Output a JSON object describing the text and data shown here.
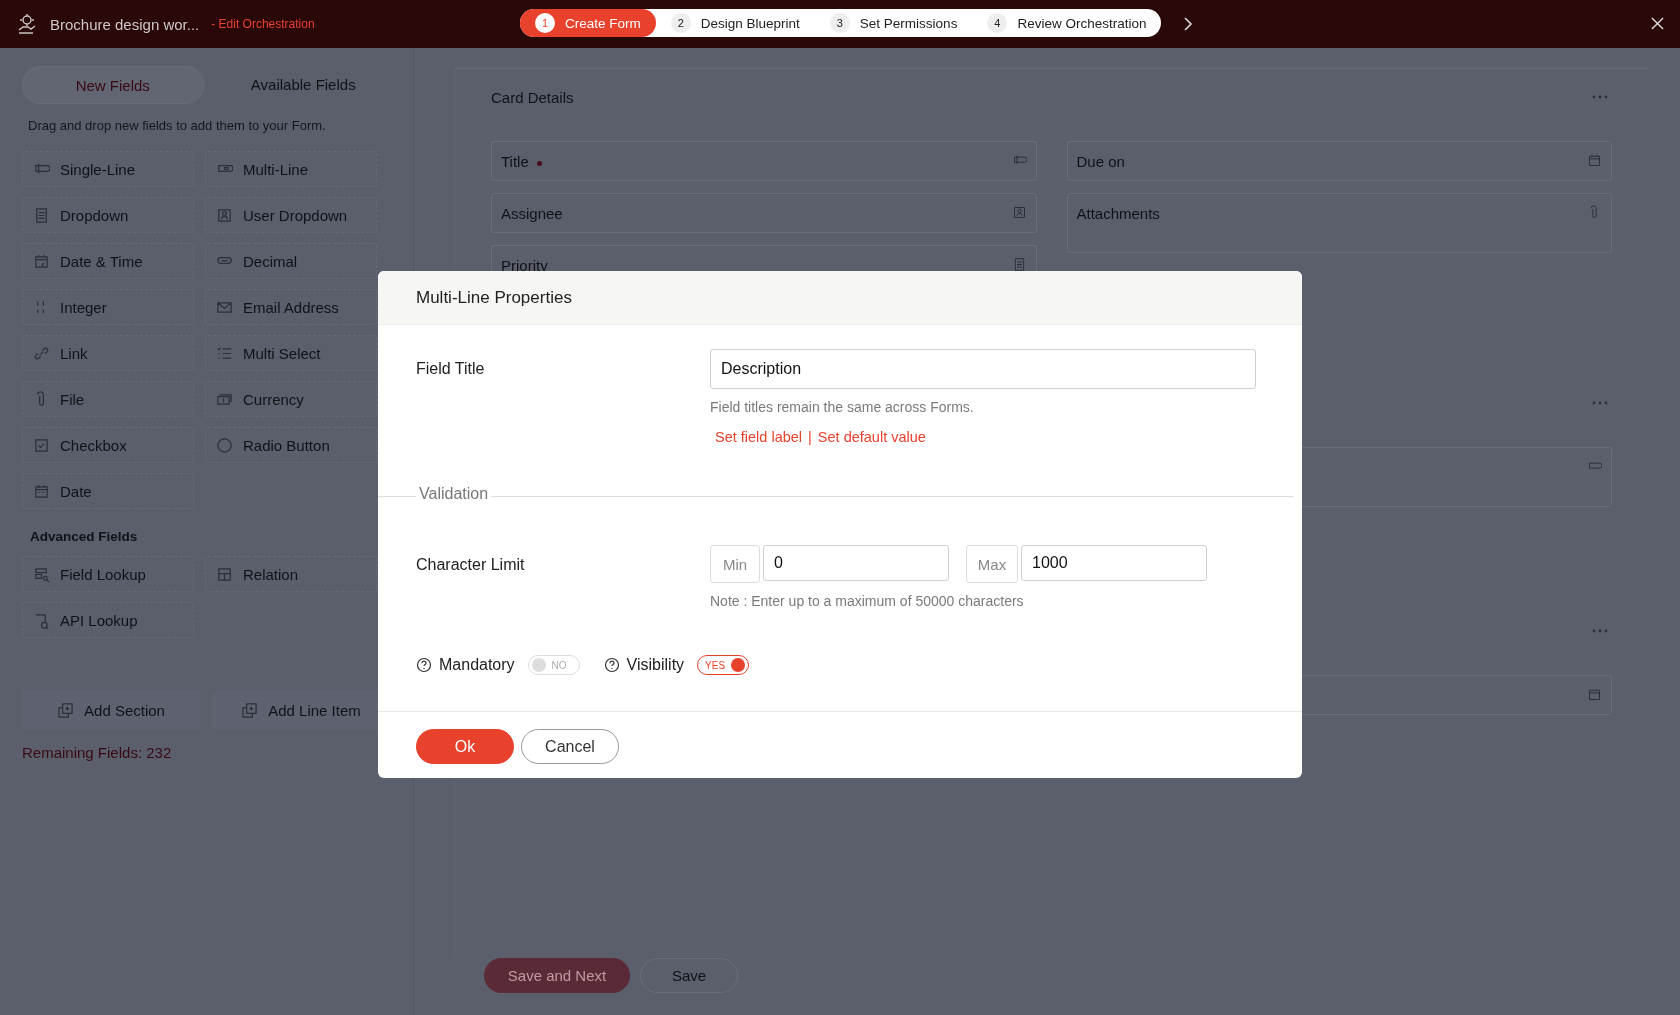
{
  "top_bar": {
    "title": "Brochure design wor...",
    "subtitle": "- Edit Orchestration",
    "steps": [
      {
        "number": "1",
        "label": "Create Form",
        "selected": true
      },
      {
        "number": "2",
        "label": "Design Blueprint",
        "selected": false
      },
      {
        "number": "3",
        "label": "Set Permissions",
        "selected": false
      },
      {
        "number": "4",
        "label": "Review Orchestration",
        "selected": false
      }
    ]
  },
  "sidebar": {
    "tabs": [
      {
        "label": "New Fields",
        "selected": true
      },
      {
        "label": "Available Fields",
        "selected": false
      }
    ],
    "hint": "Drag and drop new fields to add them to your Form.",
    "fields": [
      "Single-Line",
      "Multi-Line",
      "Dropdown",
      "User Dropdown",
      "Date & Time",
      "Decimal",
      "Integer",
      "Email Address",
      "Link",
      "Multi Select",
      "File",
      "Currency",
      "Checkbox",
      "Radio Button",
      "Date"
    ],
    "advanced_heading": "Advanced Fields",
    "advanced_fields": [
      "Field Lookup",
      "Relation",
      "API Lookup"
    ],
    "actions": [
      "Add Section",
      "Add Line Item"
    ],
    "remaining": "Remaining Fields: 232"
  },
  "form": {
    "section_title": "Card Details",
    "left_fields": [
      {
        "label": "Title",
        "required": true
      },
      {
        "label": "Assignee",
        "required": false
      },
      {
        "label": "Priority",
        "required": false
      }
    ],
    "right_fields": [
      {
        "label": "Due on",
        "required": false
      },
      {
        "label": "Attachments",
        "required": false
      }
    ],
    "buttons": [
      "Save and Next",
      "Save"
    ]
  },
  "modal": {
    "title": "Multi-Line Properties",
    "field_title": {
      "label": "Field Title",
      "value": "Description",
      "hint": "Field titles remain the same across Forms.",
      "links": [
        "Set field label",
        "Set default value"
      ],
      "link_separator": "|"
    },
    "validation": {
      "legend": "Validation",
      "label": "Character Limit",
      "min_label": "Min",
      "min_value": "0",
      "max_label": "Max",
      "max_value": "1000",
      "note": "Note : Enter up to a maximum of 50000 characters"
    },
    "toggles": [
      {
        "label": "Mandatory",
        "on": false,
        "text": "NO"
      },
      {
        "label": "Visibility",
        "on": true,
        "text": "YES"
      }
    ],
    "buttons": [
      "Ok",
      "Cancel"
    ]
  }
}
